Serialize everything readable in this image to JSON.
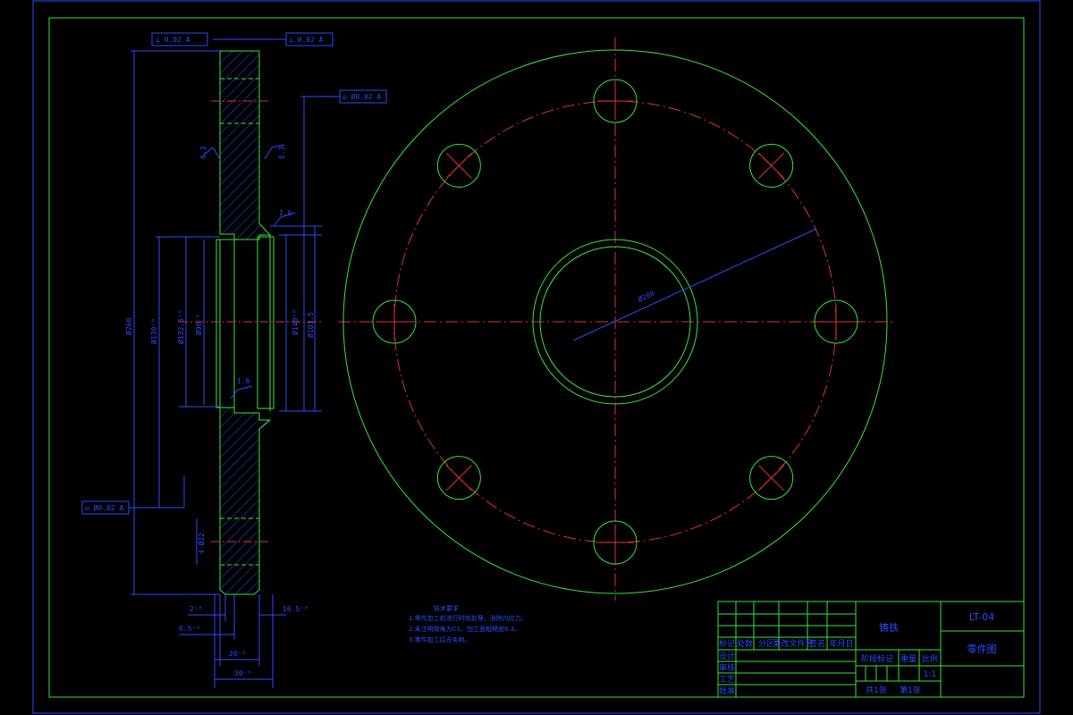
{
  "colors": {
    "background": "#000000",
    "border": "#2b4cff",
    "frame": "#37e637",
    "outline": "#37e637",
    "center_line": "#e63030",
    "dimension": "#2b4cff",
    "hatch": "#2b4cff"
  },
  "plan_view": {
    "pcd_label": "Ø200"
  },
  "section_view": {
    "flatness_top_left": "⊥ 0.02 A",
    "flatness_top_right": "⊥ 0.02 A",
    "concentric_right": "◎ Ø0.02 A",
    "concentric_left": "◎ Ø0.02 A",
    "roughness_1": "6.3",
    "roughness_2": "6.3",
    "roughness_3": "1.6",
    "roughness_4": "1.6",
    "dim_outer": "Ø260",
    "dim_2": "Ø130⁺⁰",
    "dim_3": "Ø132.5⁺⁰",
    "dim_4": "Ø98⁺⁰",
    "dim_5": "Ø140⁺⁰",
    "dim_6": "Ø101.5",
    "dim_hole": "4-Ø22",
    "dim_b1": "2⁺⁰",
    "dim_b2": "6.5⁺⁰",
    "dim_b3": "16.5⁺⁰",
    "dim_b4": "20⁺⁰",
    "dim_b5": "30⁺⁰"
  },
  "notes": {
    "title": "技术要求",
    "lines": [
      "1.零件加工前进行时效处理，消除内应力。",
      "2.未注明倒角为C1，加工面粗糙度6.3。",
      "3.零件加工后去毛刺。"
    ]
  },
  "title_block": {
    "material": "铸铁",
    "drawing_no": "LT-04",
    "drawing_name": "零件图",
    "header_labels": [
      "标记",
      "处数",
      "分区",
      "更改文件号",
      "签名",
      "年月日"
    ],
    "row_labels": [
      "设计",
      "审核",
      "工艺",
      "批准"
    ],
    "stage_label": "阶段标记",
    "weight_label": "重量",
    "scale_label": "比例",
    "scale_value": "1:1",
    "sheet_total": "共1张",
    "sheet_index": "第1张"
  }
}
